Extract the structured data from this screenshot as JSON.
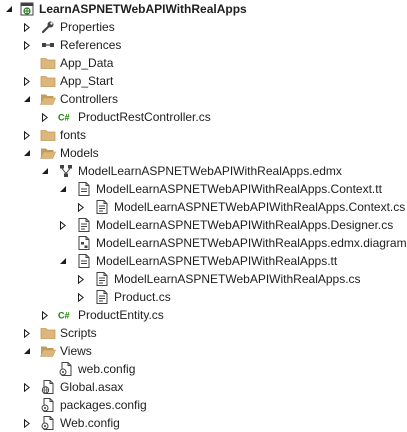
{
  "solution_explorer": {
    "nodes": [
      {
        "label": "LearnASPNETWebAPIWithRealApps",
        "depth": 0,
        "arrow": "expanded",
        "icon": "web-project",
        "bold": true
      },
      {
        "label": "Properties",
        "depth": 1,
        "arrow": "collapsed",
        "icon": "wrench"
      },
      {
        "label": "References",
        "depth": 1,
        "arrow": "collapsed",
        "icon": "references"
      },
      {
        "label": "App_Data",
        "depth": 1,
        "arrow": "none",
        "icon": "folder"
      },
      {
        "label": "App_Start",
        "depth": 1,
        "arrow": "collapsed",
        "icon": "folder"
      },
      {
        "label": "Controllers",
        "depth": 1,
        "arrow": "expanded",
        "icon": "folder-open"
      },
      {
        "label": "ProductRestController.cs",
        "depth": 2,
        "arrow": "collapsed",
        "icon": "csharp"
      },
      {
        "label": "fonts",
        "depth": 1,
        "arrow": "collapsed",
        "icon": "folder"
      },
      {
        "label": "Models",
        "depth": 1,
        "arrow": "expanded",
        "icon": "folder-open"
      },
      {
        "label": "ModelLearnASPNETWebAPIWithRealApps.edmx",
        "depth": 2,
        "arrow": "expanded",
        "icon": "edmx"
      },
      {
        "label": "ModelLearnASPNETWebAPIWithRealApps.Context.tt",
        "depth": 3,
        "arrow": "expanded",
        "icon": "tt"
      },
      {
        "label": "ModelLearnASPNETWebAPIWithRealApps.Context.cs",
        "depth": 4,
        "arrow": "collapsed",
        "icon": "cs-file"
      },
      {
        "label": "ModelLearnASPNETWebAPIWithRealApps.Designer.cs",
        "depth": 3,
        "arrow": "collapsed",
        "icon": "cs-file"
      },
      {
        "label": "ModelLearnASPNETWebAPIWithRealApps.edmx.diagram",
        "depth": 3,
        "arrow": "none",
        "icon": "diagram"
      },
      {
        "label": "ModelLearnASPNETWebAPIWithRealApps.tt",
        "depth": 3,
        "arrow": "expanded",
        "icon": "tt"
      },
      {
        "label": "ModelLearnASPNETWebAPIWithRealApps.cs",
        "depth": 4,
        "arrow": "collapsed",
        "icon": "cs-file"
      },
      {
        "label": "Product.cs",
        "depth": 4,
        "arrow": "collapsed",
        "icon": "cs-file"
      },
      {
        "label": "ProductEntity.cs",
        "depth": 2,
        "arrow": "collapsed",
        "icon": "csharp"
      },
      {
        "label": "Scripts",
        "depth": 1,
        "arrow": "collapsed",
        "icon": "folder"
      },
      {
        "label": "Views",
        "depth": 1,
        "arrow": "expanded",
        "icon": "folder-open"
      },
      {
        "label": "web.config",
        "depth": 2,
        "arrow": "none",
        "icon": "config"
      },
      {
        "label": "Global.asax",
        "depth": 1,
        "arrow": "collapsed",
        "icon": "global-asax"
      },
      {
        "label": "packages.config",
        "depth": 1,
        "arrow": "none",
        "icon": "config"
      },
      {
        "label": "Web.config",
        "depth": 1,
        "arrow": "collapsed",
        "icon": "config"
      }
    ]
  },
  "colors": {
    "folder": "#dcb67a",
    "csharp": "#178600",
    "text": "#1e1e1e",
    "arrow": "#1e1e1e"
  }
}
